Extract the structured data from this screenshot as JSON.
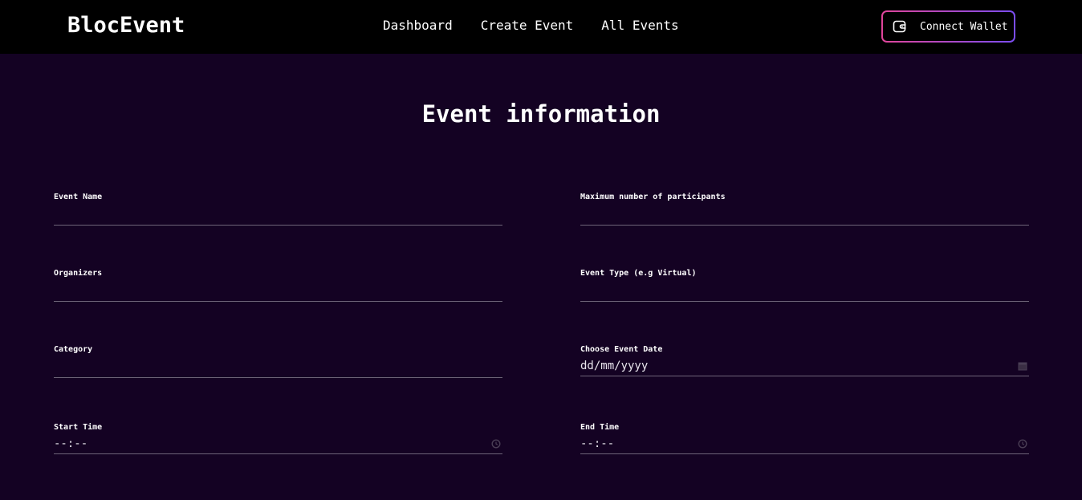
{
  "header": {
    "brand": "BlocEvent",
    "nav": [
      {
        "label": "Dashboard"
      },
      {
        "label": "Create Event"
      },
      {
        "label": "All Events"
      }
    ],
    "wallet_button": {
      "label": "Connect Wallet",
      "icon": "wallet-icon"
    }
  },
  "form": {
    "title": "Event information",
    "fields": {
      "event_name": {
        "label": "Event Name",
        "value": ""
      },
      "max_participants": {
        "label": "Maximum number of participants",
        "value": ""
      },
      "organizers": {
        "label": "Organizers",
        "value": ""
      },
      "event_type": {
        "label": "Event Type (e.g Virtual)",
        "value": ""
      },
      "category": {
        "label": "Category",
        "value": ""
      },
      "event_date": {
        "label": "Choose Event Date",
        "placeholder": "dd/mm/yyyy",
        "icon": "calendar-icon"
      },
      "start_time": {
        "label": "Start Time",
        "placeholder": "--:--",
        "icon": "clock-icon"
      },
      "end_time": {
        "label": "End Time",
        "placeholder": "--:--",
        "icon": "clock-icon"
      }
    }
  },
  "colors": {
    "background": "#140223",
    "header_background": "#000000",
    "wallet_border_start": "#e0459a",
    "wallet_border_end": "#7a4df0",
    "input_underline": "#6e6478"
  }
}
